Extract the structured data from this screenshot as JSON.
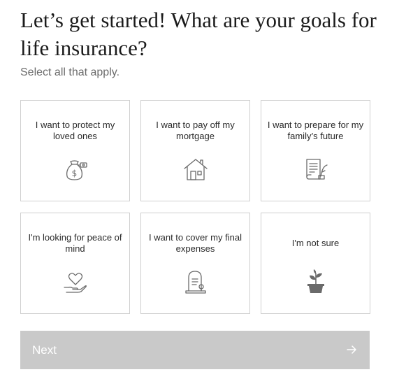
{
  "header": {
    "title": "Let’s get started! What are your goals for life insurance?",
    "subtitle": "Select all that apply."
  },
  "options": [
    {
      "label": "I want to protect my loved ones",
      "icon": "money-bag-icon"
    },
    {
      "label": "I want to pay off my mortgage",
      "icon": "house-icon"
    },
    {
      "label": "I want to prepare for my family’s future",
      "icon": "document-quill-icon"
    },
    {
      "label": "I'm looking for peace of mind",
      "icon": "heart-hand-icon"
    },
    {
      "label": "I want to cover my final expenses",
      "icon": "gravestone-icon"
    },
    {
      "label": "I'm not sure",
      "icon": "potted-plant-icon"
    }
  ],
  "footer": {
    "next_label": "Next",
    "next_icon": "arrow-right-icon",
    "button_color": "#c9c9c9"
  },
  "colors": {
    "card_border": "#cfcfcf",
    "icon_stroke": "#6a6a6a"
  }
}
